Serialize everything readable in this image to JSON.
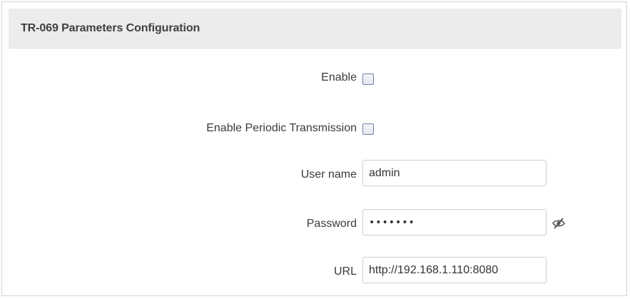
{
  "section": {
    "title": "TR-069 Parameters Configuration"
  },
  "fields": {
    "enable": {
      "label": "Enable",
      "checked": false
    },
    "periodic": {
      "label": "Enable Periodic Transmission",
      "checked": false
    },
    "username": {
      "label": "User name",
      "value": "admin"
    },
    "password": {
      "label": "Password",
      "value": "•••••••"
    },
    "url": {
      "label": "URL",
      "value": "http://192.168.1.110:8080"
    }
  },
  "icons": {
    "password_toggle": "eye-slash-icon"
  }
}
